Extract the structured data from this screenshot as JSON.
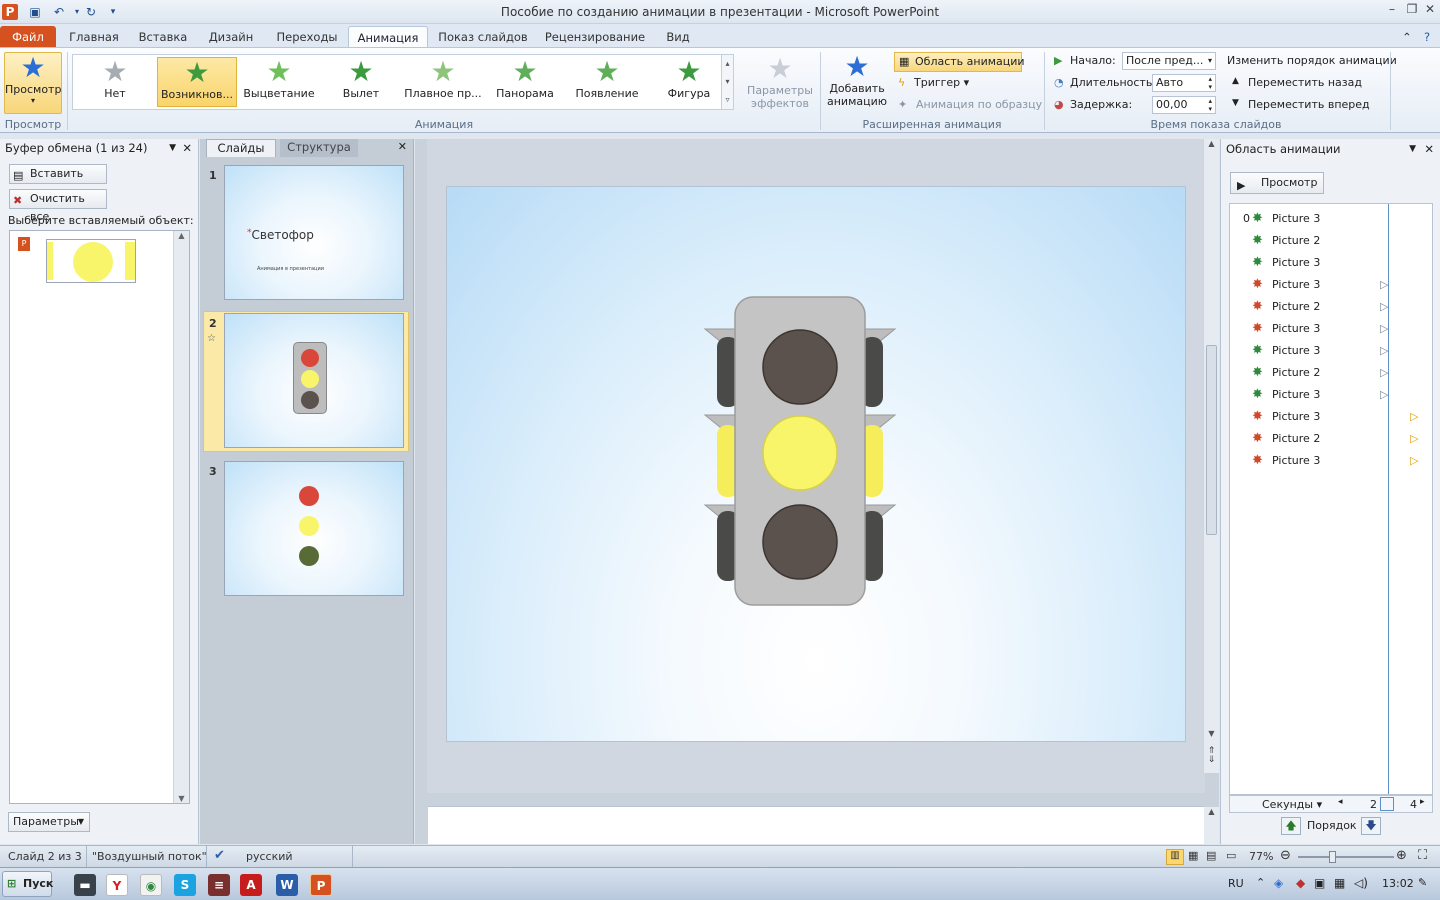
{
  "window": {
    "title": "Пособие по созданию анимации в презентации  -  Microsoft PowerPoint",
    "minimize": "–",
    "restore": "❐",
    "close": "✕"
  },
  "tabs": [
    "Файл",
    "Главная",
    "Вставка",
    "Дизайн",
    "Переходы",
    "Анимация",
    "Показ слайдов",
    "Рецензирование",
    "Вид"
  ],
  "ribbon": {
    "preview_label": "Просмотр",
    "preview_group": "Просмотр",
    "gallery": [
      "Нет",
      "Возникнов...",
      "Выцветание",
      "Вылет",
      "Плавное пр...",
      "Панорама",
      "Появление",
      "Фигура"
    ],
    "effect_params": "Параметры эффектов",
    "animation_group": "Анимация",
    "add_animation": "Добавить анимацию",
    "animation_pane_btn": "Область анимации",
    "trigger": "Триггер",
    "anim_painter": "Анимация по образцу",
    "advanced_group": "Расширенная анимация",
    "start_label": "Начало:",
    "start_value": "После пред...",
    "duration_label": "Длительность:",
    "duration_value": "Авто",
    "delay_label": "Задержка:",
    "delay_value": "00,00",
    "timing_group": "Время показа слайдов",
    "reorder_title": "Изменить порядок анимации",
    "move_back": "Переместить назад",
    "move_forward": "Переместить вперед"
  },
  "clipboard": {
    "header": "Буфер обмена (1 из 24)",
    "paste_all": "Вставить все",
    "clear_all": "Очистить все",
    "choose": "Выберите вставляемый объект:",
    "params": "Параметры"
  },
  "slides_pane": {
    "tab_slides": "Слайды",
    "tab_outline": "Структура",
    "slide1_title": "Светофор",
    "slide1_sub": "Анимация в презентации",
    "numbers": [
      "1",
      "2",
      "3"
    ]
  },
  "anim_pane": {
    "header": "Область анимации",
    "play": "Просмотр",
    "first_index": "0",
    "items": [
      "Picture 3",
      "Picture 2",
      "Picture 3",
      "Picture 3",
      "Picture 2",
      "Picture 3",
      "Picture 3",
      "Picture 2",
      "Picture 3",
      "Picture 3",
      "Picture 2",
      "Picture 3"
    ],
    "item_colors": [
      "#2f8a3b",
      "#2f8a3b",
      "#2f8a3b",
      "#d04a2a",
      "#d04a2a",
      "#d04a2a",
      "#2f8a3b",
      "#2f8a3b",
      "#2f8a3b",
      "#d04a2a",
      "#d04a2a",
      "#d04a2a"
    ],
    "seconds": "Секунды",
    "scale_a": "2",
    "scale_b": "4",
    "order": "Порядок"
  },
  "status": {
    "slide": "Слайд 2 из 3",
    "theme": "\"Воздушный поток\"",
    "lang": "русский",
    "zoom": "77%"
  },
  "taskbar": {
    "start": "Пуск",
    "lang": "RU",
    "time": "13:02"
  },
  "colors": {
    "accent": "#d5511f",
    "yellow": "#f9f56a",
    "dark_lamp": "#5c524d",
    "red_lamp": "#d8473a",
    "green_lamp": "#586b37"
  }
}
